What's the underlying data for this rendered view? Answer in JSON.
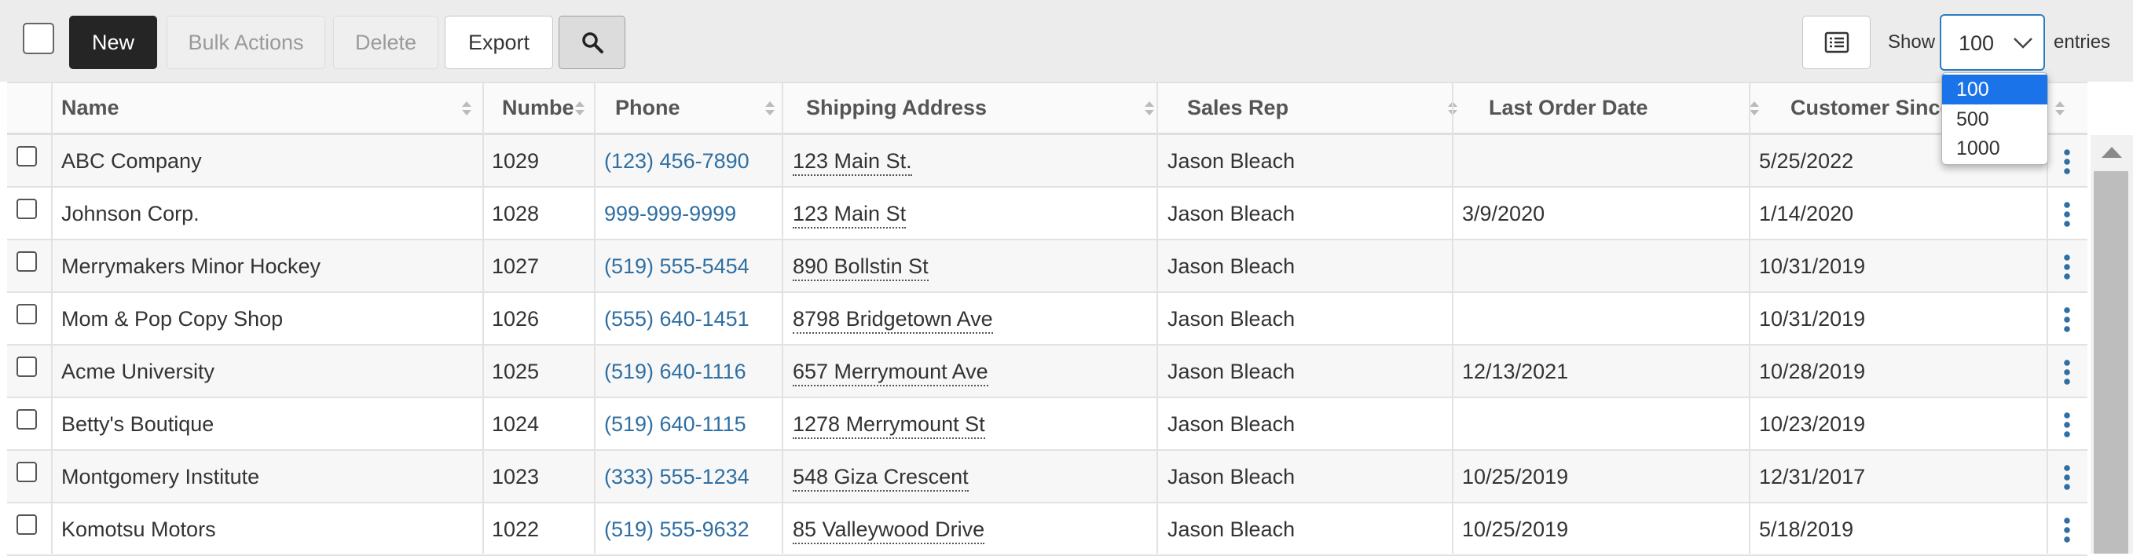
{
  "toolbar": {
    "new_label": "New",
    "bulk_label": "Bulk Actions",
    "delete_label": "Delete",
    "export_label": "Export",
    "show_label": "Show",
    "entries_label": "entries",
    "page_size_value": "100"
  },
  "page_size_options": [
    "100",
    "500",
    "1000"
  ],
  "columns": [
    "Name",
    "Number",
    "Phone",
    "Shipping Address",
    "Sales Rep",
    "Last Order Date",
    "Customer Since"
  ],
  "rows": [
    {
      "name": "ABC Company",
      "number": "1029",
      "phone": "(123) 456-7890",
      "address": "123 Main St.",
      "rep": "Jason Bleach",
      "last_order": "",
      "since": "5/25/2022"
    },
    {
      "name": "Johnson Corp.",
      "number": "1028",
      "phone": "999-999-9999",
      "address": "123 Main St",
      "rep": "Jason Bleach",
      "last_order": "3/9/2020",
      "since": "1/14/2020"
    },
    {
      "name": "Merrymakers Minor Hockey",
      "number": "1027",
      "phone": "(519) 555-5454",
      "address": "890 Bollstin St",
      "rep": "Jason Bleach",
      "last_order": "",
      "since": "10/31/2019"
    },
    {
      "name": "Mom & Pop Copy Shop",
      "number": "1026",
      "phone": "(555) 640-1451",
      "address": "8798 Bridgetown Ave",
      "rep": "Jason Bleach",
      "last_order": "",
      "since": "10/31/2019"
    },
    {
      "name": "Acme University",
      "number": "1025",
      "phone": "(519) 640-1116",
      "address": "657 Merrymount Ave",
      "rep": "Jason Bleach",
      "last_order": "12/13/2021",
      "since": "10/28/2019"
    },
    {
      "name": "Betty's Boutique",
      "number": "1024",
      "phone": "(519) 640-1115",
      "address": "1278 Merrymount St",
      "rep": "Jason Bleach",
      "last_order": "",
      "since": "10/23/2019"
    },
    {
      "name": "Montgomery Institute",
      "number": "1023",
      "phone": "(333) 555-1234",
      "address": "548 Giza Crescent",
      "rep": "Jason Bleach",
      "last_order": "10/25/2019",
      "since": "12/31/2017"
    },
    {
      "name": "Komotsu Motors",
      "number": "1022",
      "phone": "(519) 555-9632",
      "address": "85 Valleywood Drive",
      "rep": "Jason Bleach",
      "last_order": "10/25/2019",
      "since": "5/18/2019"
    }
  ],
  "colors": {
    "accent": "#2d7cc3",
    "link": "#2f6fa3",
    "selected_option": "#1a73e8"
  }
}
